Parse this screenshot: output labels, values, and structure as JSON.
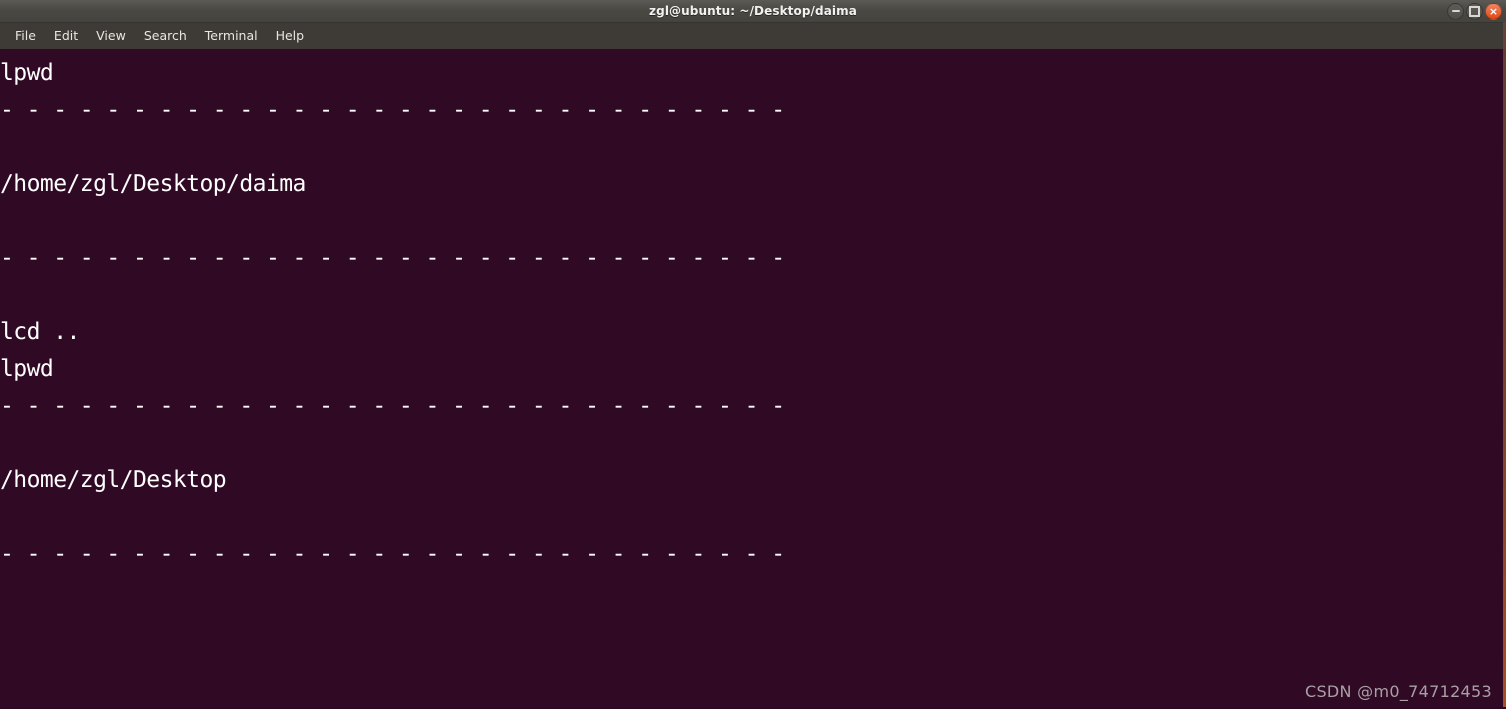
{
  "window": {
    "title": "zgl@ubuntu: ~/Desktop/daima",
    "controls": {
      "minimize_label": "–",
      "maximize_label": "",
      "close_label": "×"
    },
    "colors": {
      "terminal_background": "#300a24",
      "terminal_foreground": "#ffffff",
      "titlebar_background": "#4b4944",
      "menubar_background": "#3e3b37",
      "close_button": "#dd4814",
      "frame_accent": "#c05a23"
    }
  },
  "menubar": {
    "items": [
      {
        "label": "File"
      },
      {
        "label": "Edit"
      },
      {
        "label": "View"
      },
      {
        "label": "Search"
      },
      {
        "label": "Terminal"
      },
      {
        "label": "Help"
      }
    ]
  },
  "terminal": {
    "lines": [
      {
        "text": "lpwd"
      },
      {
        "text": "- - - - - - - - - - - - - - - - - - - - - - - - - - - - - -"
      },
      {
        "text": ""
      },
      {
        "text": "/home/zgl/Desktop/daima"
      },
      {
        "text": ""
      },
      {
        "text": "- - - - - - - - - - - - - - - - - - - - - - - - - - - - - -"
      },
      {
        "text": ""
      },
      {
        "text": "lcd .."
      },
      {
        "text": "lpwd"
      },
      {
        "text": "- - - - - - - - - - - - - - - - - - - - - - - - - - - - - -"
      },
      {
        "text": ""
      },
      {
        "text": "/home/zgl/Desktop"
      },
      {
        "text": ""
      },
      {
        "text": "- - - - - - - - - - - - - - - - - - - - - - - - - - - - - -"
      }
    ]
  },
  "watermark": {
    "text": "CSDN @m0_74712453"
  }
}
